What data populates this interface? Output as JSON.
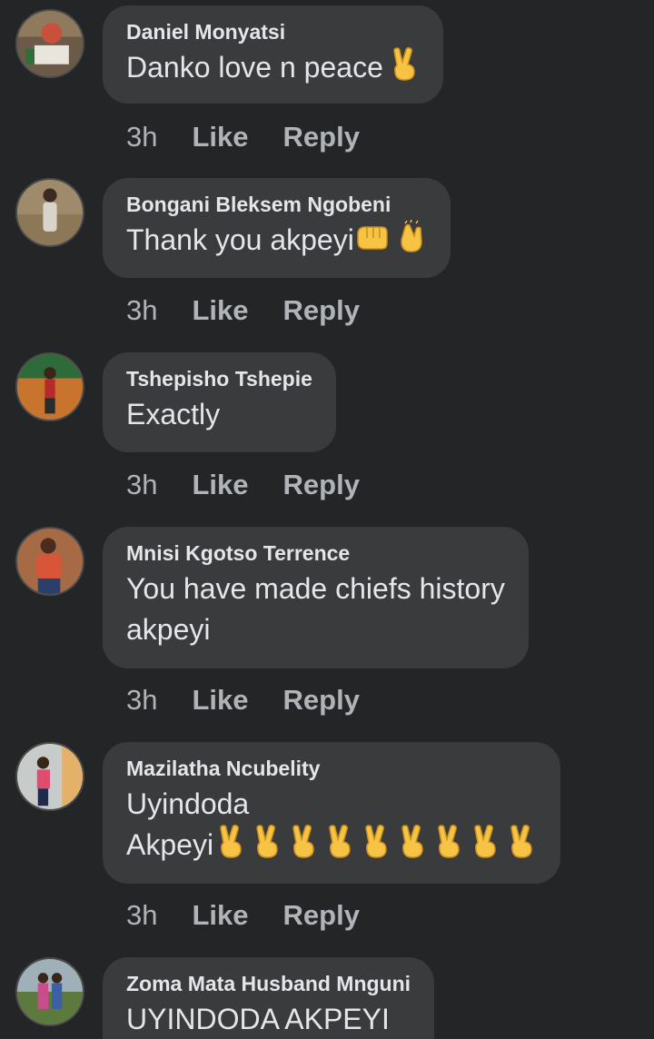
{
  "comments": [
    {
      "author": "Daniel Monyatsi",
      "lines": [
        "Danko love n peace"
      ],
      "emojis": [
        "victory-hand"
      ],
      "time": "3h",
      "like_label": "Like",
      "reply_label": "Reply"
    },
    {
      "author": "Bongani Bleksem Ngobeni",
      "lines": [
        "Thank you akpeyi"
      ],
      "emojis": [
        "oncoming-fist",
        "clapping-hands"
      ],
      "time": "3h",
      "like_label": "Like",
      "reply_label": "Reply"
    },
    {
      "author": "Tshepisho Tshepie",
      "lines": [
        "Exactly"
      ],
      "emojis": [],
      "time": "3h",
      "like_label": "Like",
      "reply_label": "Reply"
    },
    {
      "author": "Mnisi Kgotso Terrence",
      "lines": [
        "You have made chiefs history",
        "akpeyi"
      ],
      "emojis": [],
      "time": "3h",
      "like_label": "Like",
      "reply_label": "Reply"
    },
    {
      "author": "Mazilatha Ncubelity",
      "lines": [
        "Uyindoda",
        "Akpeyi"
      ],
      "emojis": [
        "victory-hand",
        "victory-hand",
        "victory-hand",
        "victory-hand",
        "victory-hand",
        "victory-hand",
        "victory-hand",
        "victory-hand",
        "victory-hand"
      ],
      "time": "3h",
      "like_label": "Like",
      "reply_label": "Reply"
    },
    {
      "author": "Zoma Mata Husband Mnguni",
      "lines": [
        "UYINDODA AKPEYI"
      ],
      "emojis": [],
      "time": "",
      "like_label": "",
      "reply_label": ""
    }
  ],
  "colors": {
    "background": "#242527",
    "bubble": "#3a3b3c",
    "primary_text": "#e4e6eb",
    "secondary_text": "#b0b3b8",
    "emoji_yellow": "#f6c344"
  }
}
